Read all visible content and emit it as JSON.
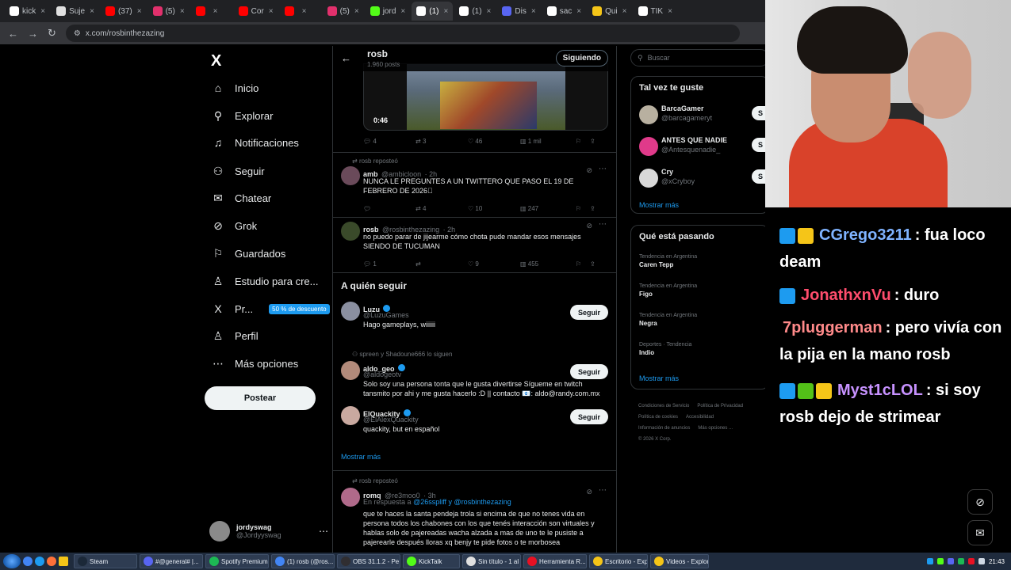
{
  "browser": {
    "tabs": [
      {
        "label": "kick",
        "color": "#ffffff"
      },
      {
        "label": "Suje",
        "color": "#e0e0e0"
      },
      {
        "label": "(37)",
        "color": "#ff0000"
      },
      {
        "label": "(5)",
        "color": "#e1306c"
      },
      {
        "label": "",
        "color": "#ff0000"
      },
      {
        "label": "Cor",
        "color": "#ff0000"
      },
      {
        "label": "",
        "color": "#ff0000"
      },
      {
        "label": "(5)",
        "color": "#e1306c"
      },
      {
        "label": "jord",
        "color": "#53fc18"
      },
      {
        "label": "(1)",
        "color": "#ffffff",
        "active": true
      },
      {
        "label": "(1)",
        "color": "#ffffff"
      },
      {
        "label": "Dis",
        "color": "#5865f2"
      },
      {
        "label": "sac",
        "color": "#ffffff"
      },
      {
        "label": "Qui",
        "color": "#f5c518"
      },
      {
        "label": "TIK",
        "color": "#ffffff"
      }
    ],
    "url": "x.com/rosbinthezazing"
  },
  "nav": {
    "logo": "X",
    "items": [
      {
        "label": "Inicio",
        "icon": "home-icon",
        "glyph": "⌂"
      },
      {
        "label": "Explorar",
        "icon": "search-icon",
        "glyph": "⚲"
      },
      {
        "label": "Notificaciones",
        "icon": "bell-icon",
        "glyph": "♫"
      },
      {
        "label": "Seguir",
        "icon": "add-user-icon",
        "glyph": "⚇"
      },
      {
        "label": "Chatear",
        "icon": "mail-icon",
        "glyph": "✉"
      },
      {
        "label": "Grok",
        "icon": "grok-icon",
        "glyph": "⊘"
      },
      {
        "label": "Guardados",
        "icon": "bookmark-icon",
        "glyph": "⚐"
      },
      {
        "label": "Estudio para cre...",
        "icon": "studio-icon",
        "glyph": "♙"
      },
      {
        "label": "Pr...",
        "icon": "x-premium-icon",
        "glyph": "X",
        "promo": "50 % de descuento"
      },
      {
        "label": "Perfil",
        "icon": "profile-icon",
        "glyph": "♙"
      },
      {
        "label": "Más opciones",
        "icon": "more-icon",
        "glyph": "⋯"
      }
    ],
    "post_button": "Postear",
    "account": {
      "name": "jordyswag",
      "handle": "@Jordyyswag"
    }
  },
  "profile_header": {
    "name": "rosb",
    "posts": "1.960 posts",
    "following_button": "Siguiendo"
  },
  "video_tweet": {
    "duration": "0:46",
    "replies": "4",
    "reposts": "3",
    "likes": "46",
    "views": "1 mil"
  },
  "tweets": [
    {
      "reposted_by": "rosb reposteó",
      "name": "amb",
      "handle": "@ambicloon",
      "time": "· 2h",
      "text": "NUNCA LE PREGUNTES A UN TWITTERO QUE PASO EL 19 DE FEBRERO DE 2026🏽",
      "replies": "",
      "reposts": "4",
      "likes": "10",
      "views": "247"
    },
    {
      "reposted_by": "",
      "name": "rosb",
      "handle": "@rosbinthezazing",
      "time": "· 2h",
      "text": "no puedo parar de jijearme cómo chota pude mandar esos mensajes SIENDO DE TUCUMAN",
      "replies": "1",
      "reposts": "",
      "likes": "9",
      "views": "455"
    }
  ],
  "who_to_follow": {
    "title": "A quién seguir",
    "users": [
      {
        "name": "Luzu",
        "handle": "@LuzuGames",
        "bio": "Hago gameplays, wiiiiii",
        "context": "",
        "button": "Seguir"
      },
      {
        "name": "aldo_geo",
        "handle": "@aldogeotv",
        "bio": "Solo soy una persona tonta que le gusta divertirse Sígueme en twitch tansmito por ahi y me gusta hacerlo :D || contacto 📧: aldo@randy.com.mx",
        "context": "spreen y Shadoune666 lo siguen",
        "button": "Seguir"
      },
      {
        "name": "ElQuackity",
        "handle": "@ElAlexQuackity",
        "bio": "quackity, but en español",
        "context": "",
        "button": "Seguir"
      }
    ],
    "show_more": "Mostrar más"
  },
  "reply_tweet": {
    "reposted_by": "rosb reposteó",
    "name": "romq",
    "handle": "@re3moo0",
    "time": "· 3h",
    "in_reply_to": "En respuesta a",
    "reply_targets": "@26sspliff y @rosbinthezazing",
    "text": "que te haces la santa pendeja trola si encima de que no tenes vida en persona todos los chabones con los que tenés interacción son virtuales y hablas solo de pajereadas wacha alzada a mas de uno te le pusiste a pajerearle después lloras xq benjy te pide fotos o te morbosea"
  },
  "right": {
    "search_placeholder": "Buscar",
    "suggestions_title": "Tal vez te guste",
    "suggestions": [
      {
        "name": "BarcaGamer",
        "handle": "@barcagameryt",
        "button": "S"
      },
      {
        "name": "ANTES QUE NADIE",
        "handle": "@Antesquenadie_",
        "button": "S"
      },
      {
        "name": "Cry",
        "handle": "@xCryboy",
        "button": "S"
      }
    ],
    "show_more": "Mostrar más",
    "trends_title": "Qué está pasando",
    "trends": [
      {
        "category": "Tendencia en Argentina",
        "name": "Caren Tepp"
      },
      {
        "category": "Tendencia en Argentina",
        "name": "Figo"
      },
      {
        "category": "Tendencia en Argentina",
        "name": "Negra"
      },
      {
        "category": "Deportes · Tendencia",
        "name": "Indio"
      }
    ],
    "trends_more": "Mostrar más",
    "footer": [
      "Condiciones de Servicio",
      "Política de Privacidad",
      "Política de cookies",
      "Accesibilidad",
      "Información de anuncios",
      "Más opciones ...",
      "© 2026 X Corp."
    ]
  },
  "chat": [
    {
      "user": "CGrego3211",
      "user_color": "#7fb3ff",
      "msg": ": fua loco deam"
    },
    {
      "user": "JonathxnVu",
      "user_color": "#ff4d6d",
      "msg": ": duro"
    },
    {
      "user": "7pluggerman",
      "user_color": "#ff8a8a",
      "msg": ": pero vivía con la pija en la mano rosb"
    },
    {
      "user": "Myst1cLOL",
      "user_color": "#c792ff",
      "msg": ": si soy rosb dejo de strimear"
    }
  ],
  "taskbar": {
    "items": [
      {
        "label": "Steam",
        "color": "#1b2838"
      },
      {
        "label": "#@general# |...",
        "color": "#5865f2"
      },
      {
        "label": "Spotify Premium",
        "color": "#1db954"
      },
      {
        "label": "(1) rosb (@ros...",
        "color": "#4285f4"
      },
      {
        "label": "OBS 31.1.2 - Pe...",
        "color": "#302e31"
      },
      {
        "label": "KickTalk",
        "color": "#53fc18"
      },
      {
        "label": "Sin título - 1 al 8...",
        "color": "#e0e0e0"
      },
      {
        "label": "Herramienta R...",
        "color": "#e81123"
      },
      {
        "label": "Escritorio - Exp...",
        "color": "#f5c518"
      },
      {
        "label": "Videos - Explor...",
        "color": "#f5c518"
      }
    ],
    "clock": "21:43"
  }
}
